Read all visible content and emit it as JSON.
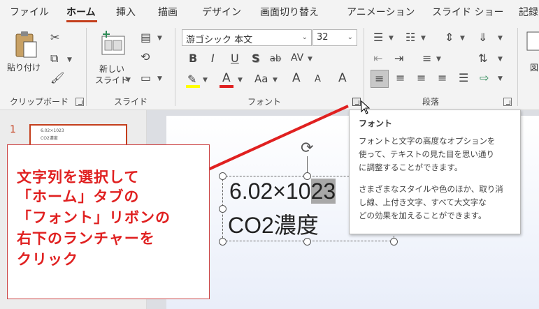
{
  "menu_tabs": [
    "ファイル",
    "ホーム",
    "挿入",
    "描画",
    "デザイン",
    "画面切り替え",
    "アニメーション",
    "スライド ショー",
    "記録"
  ],
  "active_tab": "ホーム",
  "ribbon": {
    "clipboard": {
      "paste_label": "貼り付け",
      "group_label": "クリップボード"
    },
    "slides": {
      "new_slide_line1": "新しい",
      "new_slide_line2": "スライド",
      "group_label": "スライド"
    },
    "font": {
      "font_name": "游ゴシック 本文",
      "font_size": "32",
      "bold": "B",
      "italic": "I",
      "underline": "U",
      "shadow": "S",
      "strike": "ab",
      "spacing": "AV",
      "change_case": "Aa",
      "grow": "A",
      "shrink": "A",
      "group_label": "フォント",
      "highlight_color": "#ffff00",
      "font_color": "#e02020"
    },
    "paragraph": {
      "group_label": "段落"
    },
    "right_cut_label": "図"
  },
  "slide_panel": {
    "slide_number": "1",
    "thumb_line1": "6.02×1023",
    "thumb_line2": "CO2濃度"
  },
  "textbox": {
    "line1_prefix": "6.02×10",
    "line1_selected": "23",
    "line2": "CO2濃度"
  },
  "callout": {
    "lines": [
      "文字列を選択して",
      "「ホーム」タブの",
      "「フォント」リボンの",
      "右下のランチャーを",
      "クリック"
    ],
    "accent": "#e02020"
  },
  "tooltip": {
    "title": "フォント",
    "lines": [
      "フォントと文字の高度なオプションを",
      "使って、テキストの見た目を思い通り",
      "に調整することができます。",
      "",
      "さまざまなスタイルや色のほか、取り消",
      "し線、上付き文字、すべて大文字な",
      "どの効果を加えることができます。"
    ]
  }
}
